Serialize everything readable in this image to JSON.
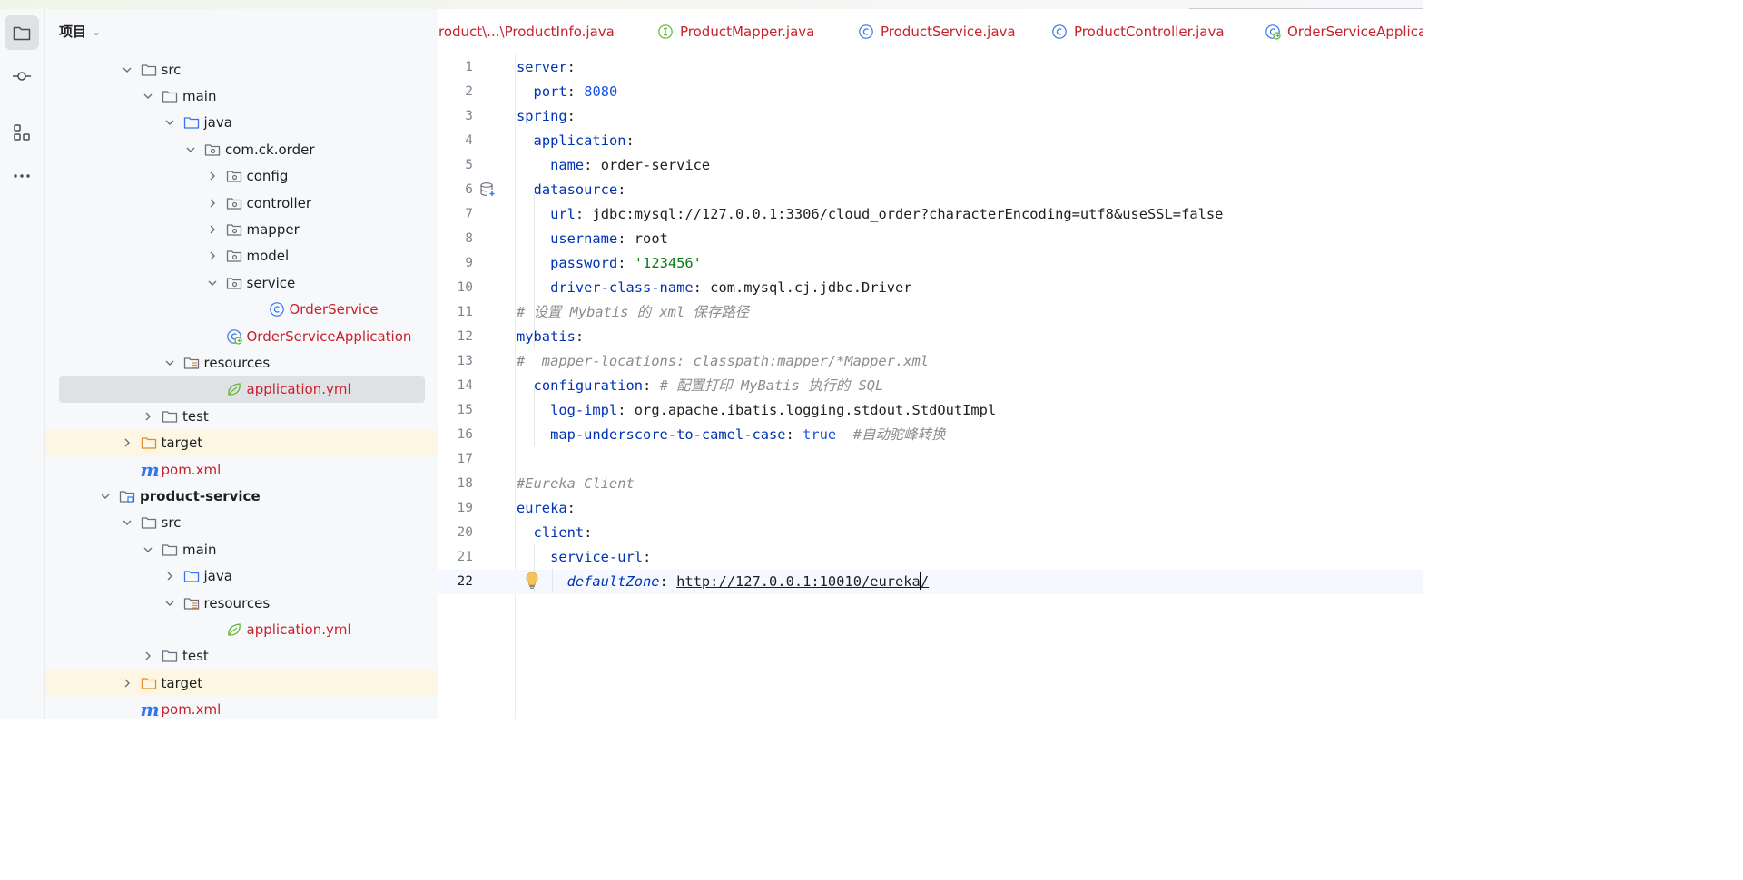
{
  "project_panel": {
    "title": "项目",
    "tree": [
      {
        "label": "src",
        "type": "folder",
        "expanded": true
      },
      {
        "label": "main",
        "type": "folder",
        "expanded": true
      },
      {
        "label": "java",
        "type": "source-folder",
        "expanded": true
      },
      {
        "label": "com.ck.order",
        "type": "package",
        "expanded": true
      },
      {
        "label": "config",
        "type": "package",
        "expanded": false
      },
      {
        "label": "controller",
        "type": "package",
        "expanded": false
      },
      {
        "label": "mapper",
        "type": "package",
        "expanded": false
      },
      {
        "label": "model",
        "type": "package",
        "expanded": false
      },
      {
        "label": "service",
        "type": "package",
        "expanded": true
      },
      {
        "label": "OrderService",
        "type": "class"
      },
      {
        "label": "OrderServiceApplication",
        "type": "spring-app"
      },
      {
        "label": "resources",
        "type": "resources-folder",
        "expanded": true
      },
      {
        "label": "application.yml",
        "type": "yml",
        "selected": true
      },
      {
        "label": "test",
        "type": "folder",
        "expanded": false
      },
      {
        "label": "target",
        "type": "excluded-folder",
        "expanded": false
      },
      {
        "label": "pom.xml",
        "type": "maven"
      },
      {
        "label": "product-service",
        "type": "module",
        "expanded": true
      },
      {
        "label": "src",
        "type": "folder",
        "expanded": true
      },
      {
        "label": "main",
        "type": "folder",
        "expanded": true
      },
      {
        "label": "java",
        "type": "source-folder",
        "expanded": false
      },
      {
        "label": "resources",
        "type": "resources-folder",
        "expanded": true
      },
      {
        "label": "application.yml",
        "type": "yml"
      },
      {
        "label": "test",
        "type": "folder",
        "expanded": false
      },
      {
        "label": "target",
        "type": "excluded-folder",
        "expanded": false
      },
      {
        "label": "pom.xml",
        "type": "maven"
      }
    ]
  },
  "tabs": [
    {
      "label": "roduct\\...\\ProductInfo.java",
      "icon": "none"
    },
    {
      "label": "ProductMapper.java",
      "icon": "interface-icon"
    },
    {
      "label": "ProductService.java",
      "icon": "class-icon"
    },
    {
      "label": "ProductController.java",
      "icon": "class-icon"
    },
    {
      "label": "OrderServiceApplicat",
      "icon": "spring-app-icon"
    }
  ],
  "editor": {
    "current_line": 22,
    "lines": [
      {
        "n": "1",
        "t": "server:"
      },
      {
        "n": "2",
        "t": "  port: 8080"
      },
      {
        "n": "3",
        "t": "spring:"
      },
      {
        "n": "4",
        "t": "  application:"
      },
      {
        "n": "5",
        "t": "    name: order-service"
      },
      {
        "n": "6",
        "t": "  datasource:"
      },
      {
        "n": "7",
        "t": "    url: jdbc:mysql://127.0.0.1:3306/cloud_order?characterEncoding=utf8&useSSL=false"
      },
      {
        "n": "8",
        "t": "    username: root"
      },
      {
        "n": "9",
        "t": "    password: '123456'"
      },
      {
        "n": "10",
        "t": "    driver-class-name: com.mysql.cj.jdbc.Driver"
      },
      {
        "n": "11",
        "t": "# 设置 Mybatis 的 xml 保存路径"
      },
      {
        "n": "12",
        "t": "mybatis:"
      },
      {
        "n": "13",
        "t": "#  mapper-locations: classpath:mapper/*Mapper.xml"
      },
      {
        "n": "14",
        "t": "  configuration: # 配置打印 MyBatis 执行的 SQL"
      },
      {
        "n": "15",
        "t": "    log-impl: org.apache.ibatis.logging.stdout.StdOutImpl"
      },
      {
        "n": "16",
        "t": "    map-underscore-to-camel-case: true  #自动驼峰转换"
      },
      {
        "n": "17",
        "t": ""
      },
      {
        "n": "18",
        "t": "#Eureka Client"
      },
      {
        "n": "19",
        "t": "eureka:"
      },
      {
        "n": "20",
        "t": "  client:"
      },
      {
        "n": "21",
        "t": "    service-url:"
      },
      {
        "n": "22",
        "t": "      defaultZone: http://127.0.0.1:10010/eureka/"
      }
    ]
  },
  "colors": {
    "accent": "#3574f0",
    "error_red": "#c7222d",
    "keyword": "#0033b3",
    "string": "#067d17"
  }
}
